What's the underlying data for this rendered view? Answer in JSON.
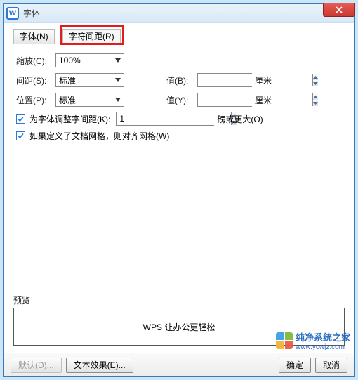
{
  "window": {
    "title": "字体"
  },
  "tabs": {
    "font": "字体(N)",
    "spacing": "字符间距(R)"
  },
  "form": {
    "scale_label": "缩放(C):",
    "scale_value": "100%",
    "spacing_label": "间距(S):",
    "spacing_value": "标准",
    "position_label": "位置(P):",
    "position_value": "标准",
    "valb_label": "值(B):",
    "valb_value": "",
    "valy_label": "值(Y):",
    "valy_value": "",
    "unit_cm": "厘米",
    "adjust_label": "为字体调整字间距(K):",
    "adjust_value": "1",
    "adjust_unit": "磅或更大(O)",
    "grid_label": "如果定义了文档网格，则对齐网格(W)"
  },
  "preview": {
    "label": "预览",
    "text": "WPS 让办公更轻松"
  },
  "footer": {
    "default": "默认(D)...",
    "effects": "文本效果(E)...",
    "ok": "确定",
    "cancel": "取消"
  },
  "watermark": {
    "line1": "纯净系统之家",
    "line2": "www.ycwjz.com"
  }
}
